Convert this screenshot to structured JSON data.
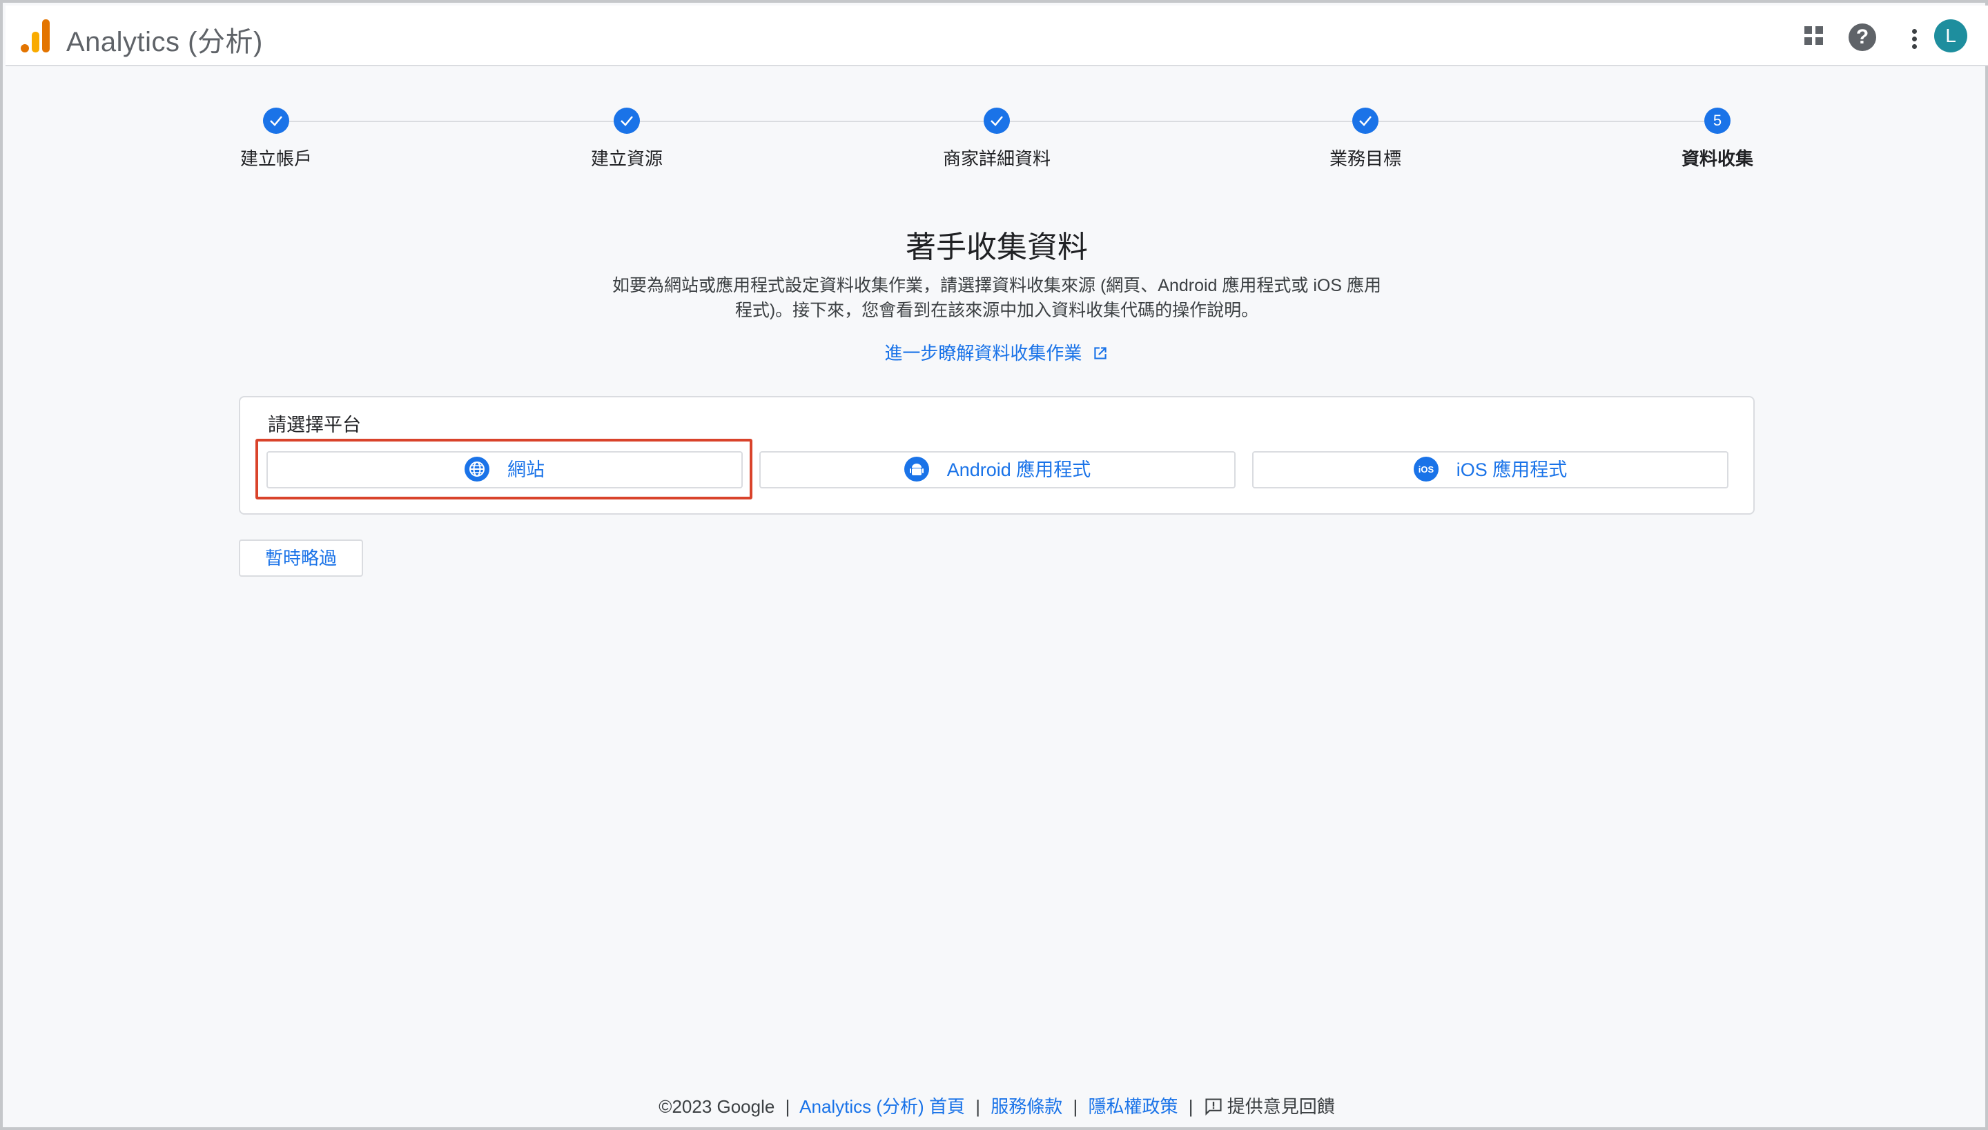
{
  "header": {
    "app_title": "Analytics (分析)",
    "avatar_letter": "L",
    "icons": [
      "analytics-logo-icon",
      "apps-grid-icon",
      "help-icon",
      "more-vert-icon"
    ]
  },
  "stepper": {
    "steps": [
      {
        "label": "建立帳戶",
        "state": "done"
      },
      {
        "label": "建立資源",
        "state": "done"
      },
      {
        "label": "商家詳細資料",
        "state": "done"
      },
      {
        "label": "業務目標",
        "state": "done"
      },
      {
        "label": "資料收集",
        "state": "current",
        "number": "5"
      }
    ]
  },
  "main": {
    "heading": "著手收集資料",
    "description_line1": "如要為網站或應用程式設定資料收集作業，請選擇資料收集來源 (網頁、Android 應用程式或 iOS 應用",
    "description_line2": "程式)。接下來，您會看到在該來源中加入資料收集代碼的操作說明。",
    "learn_more_link": "進一步瞭解資料收集作業"
  },
  "platform_card": {
    "title": "請選擇平台",
    "buttons": [
      {
        "label": "網站",
        "icon": "globe-icon",
        "highlighted": true
      },
      {
        "label": "Android 應用程式",
        "icon": "android-icon"
      },
      {
        "label": "iOS 應用程式",
        "icon": "ios-icon"
      }
    ]
  },
  "skip_button": "暫時略過",
  "footer": {
    "copyright": "©2023 Google",
    "home_link": "Analytics (分析) 首頁",
    "terms_link": "服務條款",
    "privacy_link": "隱私權政策",
    "feedback_link": "提供意見回饋",
    "separator": "|"
  },
  "colors": {
    "accent": "#1a73e8",
    "highlight_border": "#d9432b",
    "logo_orange": "#e37400",
    "logo_yellow": "#f9ab00",
    "avatar_bg": "#1e8e9e"
  }
}
